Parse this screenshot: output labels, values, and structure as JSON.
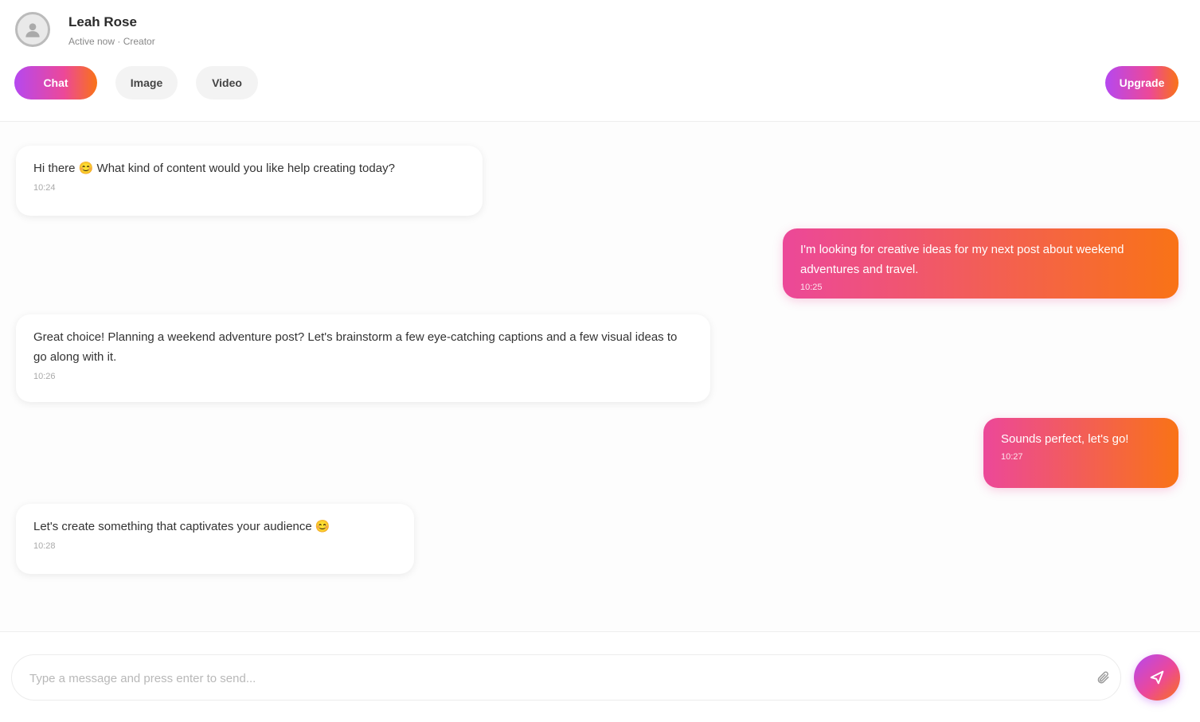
{
  "contact": {
    "name": "Leah Rose",
    "status": "Active now · Creator"
  },
  "tabs": [
    {
      "label": "Chat"
    },
    {
      "label": "Image"
    },
    {
      "label": "Video"
    }
  ],
  "header_action": {
    "label": "Upgrade"
  },
  "messages": [
    {
      "from": "contact",
      "text": "Hi there 😊 What kind of content would you like help creating today?",
      "time": "10:24"
    },
    {
      "from": "user",
      "text": "I'm looking for creative ideas for my next post about weekend adventures and travel.",
      "time": "10:25"
    },
    {
      "from": "contact",
      "text": "Great choice! Planning a weekend adventure post? Let's brainstorm a few eye-catching captions and a few visual ideas to go along with it.",
      "time": "10:26"
    },
    {
      "from": "user",
      "text": "Sounds perfect, let's go!",
      "time": "10:27"
    },
    {
      "from": "contact",
      "text": "Let's create something that captivates your audience 😊",
      "time": "10:28"
    }
  ],
  "composer": {
    "placeholder": "Type a message and press enter to send..."
  },
  "icons": {
    "avatar": "user-icon",
    "attach": "paperclip-icon",
    "send": "send-icon"
  },
  "colors": {
    "gradient_start": "#b548f0",
    "gradient_mid": "#ec4899",
    "gradient_end": "#f97316"
  }
}
